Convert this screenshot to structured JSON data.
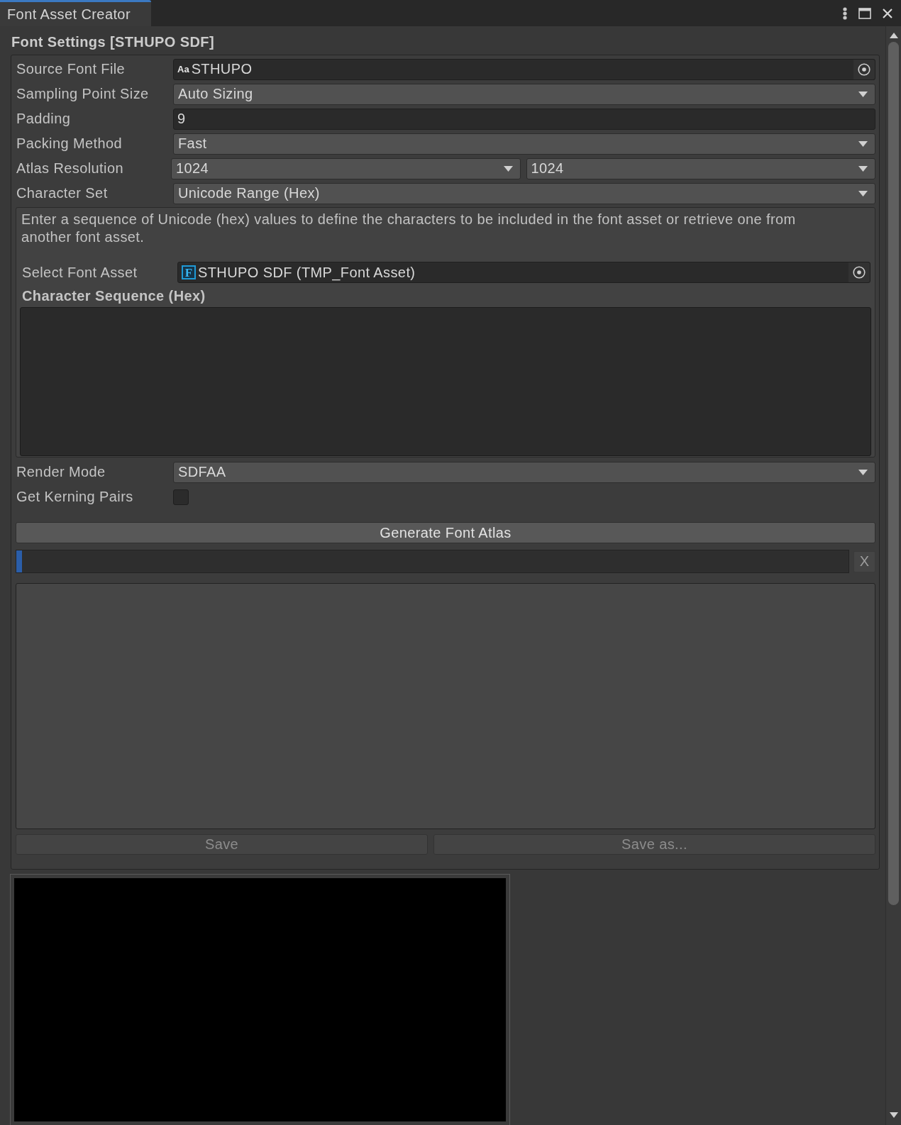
{
  "window": {
    "tab": {
      "label": "Font Asset Creator",
      "selected": true
    }
  },
  "section_title": "Font Settings [STHUPO SDF]",
  "fields": [
    {
      "kind": "object",
      "label": "Source Font File",
      "icon_glyph": "Aa",
      "value": "STHUPO"
    },
    {
      "kind": "dropdown",
      "label": "Sampling Point Size",
      "value": "Auto Sizing"
    },
    {
      "kind": "number",
      "label": "Padding",
      "value": "9"
    },
    {
      "kind": "dropdown",
      "label": "Packing Method",
      "value": "Fast"
    },
    {
      "kind": "dropdown_pair",
      "label": "Atlas Resolution",
      "values": [
        "1024",
        "1024"
      ]
    },
    {
      "kind": "dropdown",
      "label": "Character Set",
      "value": "Unicode Range (Hex)"
    }
  ],
  "character_set_panel": {
    "help_text": "Enter a sequence of Unicode (hex) values to define the characters to be included in the font asset or retrieve one from another font asset.",
    "font_asset_field": {
      "kind": "object",
      "label": "Select Font Asset",
      "icon_glyph": "F",
      "value": "STHUPO SDF (TMP_Font Asset)"
    },
    "sequence_label": "Character Sequence (Hex)"
  },
  "render_fields": [
    {
      "kind": "dropdown",
      "label": "Render Mode",
      "value": "SDFAA"
    },
    {
      "kind": "checkbox",
      "label": "Get Kerning Pairs",
      "checked": false
    }
  ],
  "generate_button": {
    "label": "Generate Font Atlas"
  },
  "progress": {
    "level": 0.007,
    "cancel_label": "X"
  },
  "save_buttons": [
    {
      "label": "Save",
      "disabled": true
    },
    {
      "label": "Save as...",
      "disabled": true
    }
  ]
}
